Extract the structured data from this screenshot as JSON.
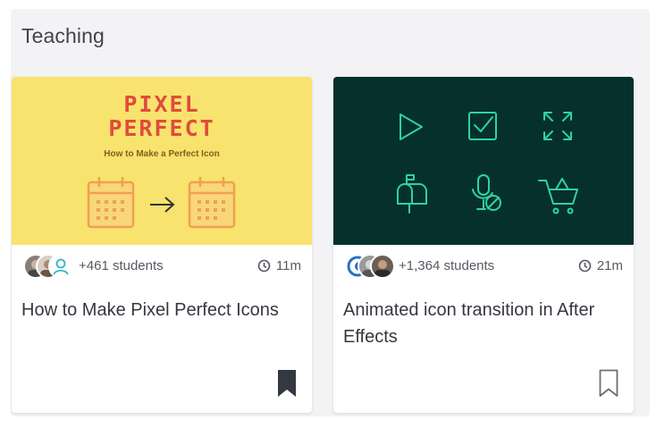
{
  "section": {
    "title": "Teaching"
  },
  "cards": [
    {
      "thumbnail": {
        "line1": "PIXEL",
        "line2": "PERFECT",
        "subtitle": "How to Make a Perfect Icon",
        "bg_color": "#f7e36d",
        "text_color": "#e24a3e",
        "icons": [
          "calendar-icon",
          "arrow-right-icon",
          "calendar-icon"
        ]
      },
      "students": "+461 students",
      "duration": "11m",
      "title": "How to Make Pixel Perfect Icons",
      "bookmarked": true
    },
    {
      "thumbnail": {
        "bg_color": "#05302d",
        "icon_color": "#2fd3a0",
        "icons": [
          "play-icon",
          "checkbox-icon",
          "expand-icon",
          "mailbox-icon",
          "mic-off-icon",
          "cart-icon"
        ]
      },
      "students": "+1,364 students",
      "duration": "21m",
      "title": "Animated icon transition in After Effects",
      "bookmarked": false
    }
  ]
}
